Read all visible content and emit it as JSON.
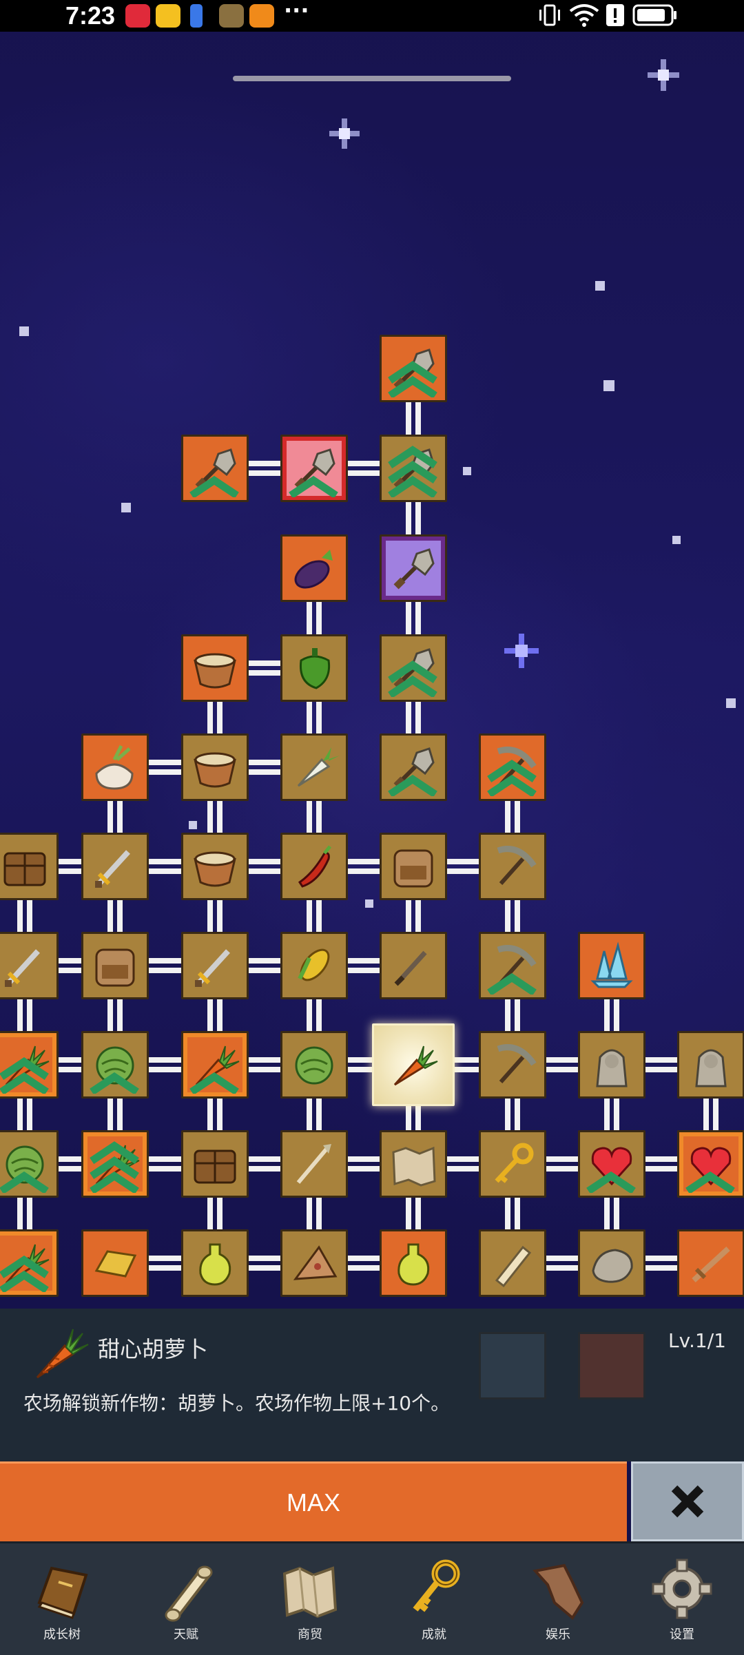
{
  "status_bar": {
    "time": "7:23",
    "more": "···"
  },
  "info": {
    "name": "甜心胡萝卜",
    "level": "Lv.1/1",
    "description": "农场解锁新作物：胡萝卜。农场作物上限+10个。"
  },
  "actions": {
    "max_label": "MAX",
    "close_icon": "close-icon"
  },
  "nav": [
    {
      "label": "成长树",
      "icon": "book-icon"
    },
    {
      "label": "天赋",
      "icon": "scroll-icon"
    },
    {
      "label": "商贸",
      "icon": "map-icon"
    },
    {
      "label": "成就",
      "icon": "key-icon"
    },
    {
      "label": "娱乐",
      "icon": "paper-icon"
    },
    {
      "label": "设置",
      "icon": "gear-icon"
    }
  ],
  "colors": {
    "orange": "#e36a2a",
    "gold_tile": "#a8823c",
    "panel": "#1f2a36",
    "nav": "#2a333e"
  },
  "selected_node": "carrot"
}
